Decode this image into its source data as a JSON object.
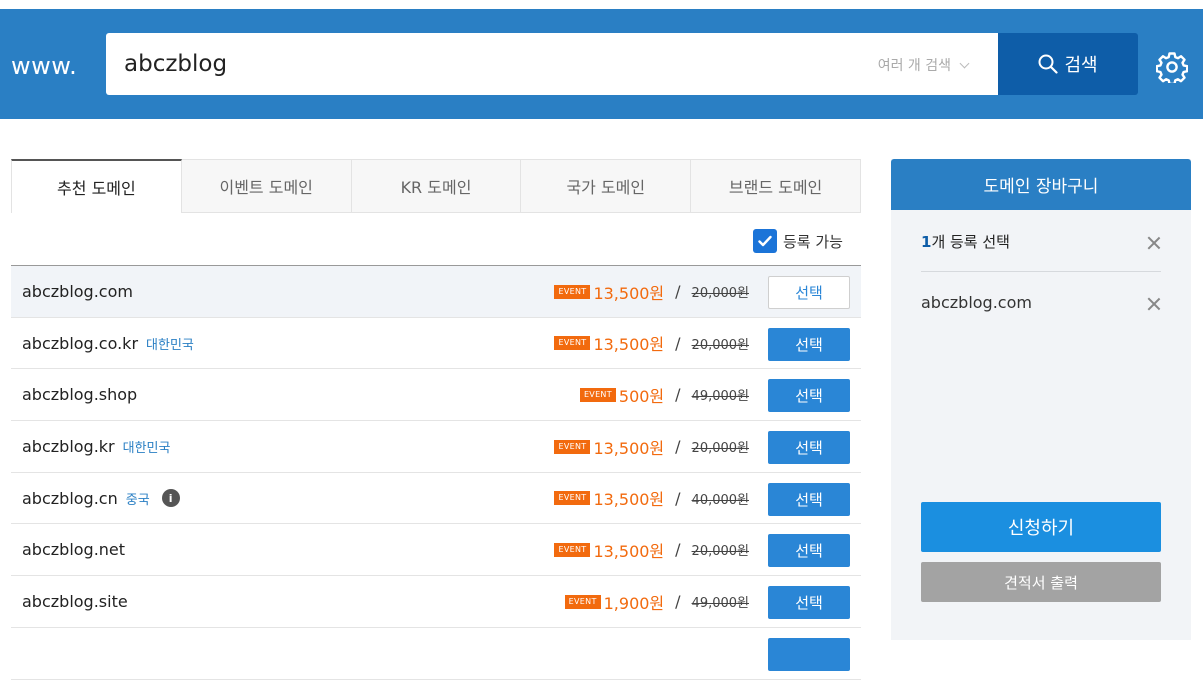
{
  "header": {
    "prefix": "www.",
    "search_value": "abczblog",
    "multi_search_label": "여러 개 검색",
    "search_button": "검색"
  },
  "tabs": [
    {
      "label": "추천 도메인",
      "active": true
    },
    {
      "label": "이벤트 도메인",
      "active": false
    },
    {
      "label": "KR 도메인",
      "active": false
    },
    {
      "label": "국가 도메인",
      "active": false
    },
    {
      "label": "브랜드 도메인",
      "active": false
    }
  ],
  "filter": {
    "available_label": "등록 가능",
    "checked": true
  },
  "event_badge": "EVENT",
  "rows": [
    {
      "domain": "abczblog.com",
      "country": "",
      "info": false,
      "price": "13,500원",
      "old_price": "20,000원",
      "button": "선택",
      "selected": true
    },
    {
      "domain": "abczblog.co.kr",
      "country": "대한민국",
      "info": false,
      "price": "13,500원",
      "old_price": "20,000원",
      "button": "선택",
      "selected": false
    },
    {
      "domain": "abczblog.shop",
      "country": "",
      "info": false,
      "price": "500원",
      "old_price": "49,000원",
      "button": "선택",
      "selected": false
    },
    {
      "domain": "abczblog.kr",
      "country": "대한민국",
      "info": false,
      "price": "13,500원",
      "old_price": "20,000원",
      "button": "선택",
      "selected": false
    },
    {
      "domain": "abczblog.cn",
      "country": "중국",
      "info": true,
      "price": "13,500원",
      "old_price": "40,000원",
      "button": "선택",
      "selected": false
    },
    {
      "domain": "abczblog.net",
      "country": "",
      "info": false,
      "price": "13,500원",
      "old_price": "20,000원",
      "button": "선택",
      "selected": false
    },
    {
      "domain": "abczblog.site",
      "country": "",
      "info": false,
      "price": "1,900원",
      "old_price": "49,000원",
      "button": "선택",
      "selected": false
    }
  ],
  "cart": {
    "title": "도메인 장바구니",
    "count": "1",
    "count_suffix": "개 등록 선택",
    "items": [
      "abczblog.com"
    ],
    "apply_button": "신청하기",
    "quote_button": "견적서 출력"
  },
  "colors": {
    "header": "#2a7fc4",
    "search_button": "#0e5da8",
    "accent": "#2a86d6",
    "event": "#f26a0e"
  }
}
